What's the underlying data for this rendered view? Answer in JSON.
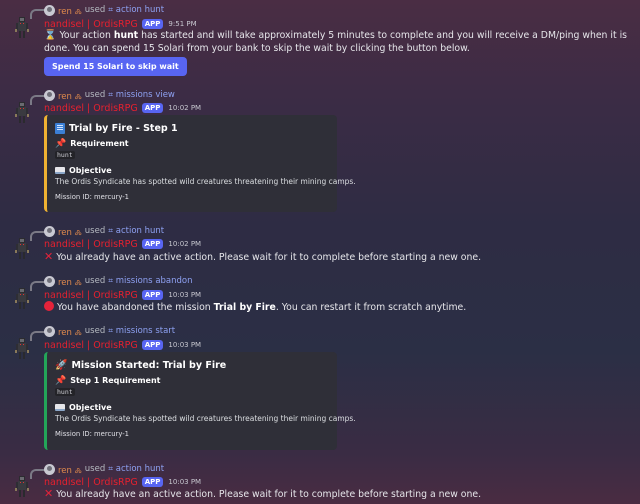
{
  "messages": [
    {
      "reply": {
        "user": "ren 🝆",
        "used": "used",
        "command": "⌗ action hunt"
      },
      "author": "nandisel | OrdisRPG",
      "badge": "APP",
      "time": "9:51 PM",
      "text_parts": [
        "Your action ",
        "hunt",
        " has started and will take approximately 5 minutes to complete and you will receive a DM/ping when it is done. You can spend 15 Solari from your bank to skip the wait by clicking the button below."
      ],
      "button": "Spend 15 Solari to skip wait"
    },
    {
      "reply": {
        "user": "ren 🝆",
        "used": "used",
        "command": "⌗ missions view"
      },
      "author": "nandisel | OrdisRPG",
      "badge": "APP",
      "time": "10:02 PM",
      "embed": {
        "title": "Trial by Fire - Step 1",
        "field1_name": "Requirement",
        "field1_value": "hunt",
        "field2_name": "Objective",
        "field2_value": "The Ordis Syndicate has spotted wild creatures threatening their mining camps.",
        "footer": "Mission ID: mercury-1"
      }
    },
    {
      "reply": {
        "user": "ren 🝆",
        "used": "used",
        "command": "⌗ action hunt"
      },
      "author": "nandisel | OrdisRPG",
      "badge": "APP",
      "time": "10:02 PM",
      "text": "You already have an active action. Please wait for it to complete before starting a new one."
    },
    {
      "reply": {
        "user": "ren 🝆",
        "used": "used",
        "command": "⌗ missions abandon"
      },
      "author": "nandisel | OrdisRPG",
      "badge": "APP",
      "time": "10:03 PM",
      "text_parts": [
        "You have abandoned the mission ",
        "Trial by Fire",
        ". You can restart it from scratch anytime."
      ]
    },
    {
      "reply": {
        "user": "ren 🝆",
        "used": "used",
        "command": "⌗ missions start"
      },
      "author": "nandisel | OrdisRPG",
      "badge": "APP",
      "time": "10:03 PM",
      "embed": {
        "title": "Mission Started: Trial by Fire",
        "field1_name": "Step 1 Requirement",
        "field1_value": "hunt",
        "field2_name": "Objective",
        "field2_value": "The Ordis Syndicate has spotted wild creatures threatening their mining camps.",
        "footer": "Mission ID: mercury-1"
      }
    },
    {
      "reply": {
        "user": "ren 🝆",
        "used": "used",
        "command": "⌗ action hunt"
      },
      "author": "nandisel | OrdisRPG",
      "badge": "APP",
      "time": "10:03 PM",
      "text": "You already have an active action. Please wait for it to complete before starting a new one."
    }
  ],
  "icons": {
    "avatar": "robot-avatar-icon",
    "hourglass": "hourglass-icon",
    "book": "blue-book-icon",
    "pin": "pushpin-icon",
    "open_book": "open-book-icon",
    "cross": "cross-mark-icon",
    "red_circle": "red-circle-icon",
    "rocket": "rocket-icon"
  },
  "colors": {
    "author": "#e5212f",
    "reply_user": "#e08a4c",
    "command": "#8ea1f2",
    "badge": "#5865f2",
    "embed_yellow": "#f0b232",
    "embed_green": "#23a559"
  }
}
